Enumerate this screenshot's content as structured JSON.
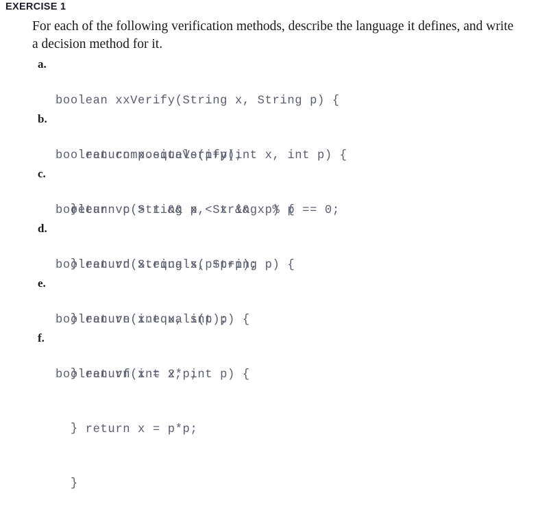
{
  "heading": "EXERCISE 1",
  "intro": {
    "line1": "For each of the following verification methods, describe the language it defines, and write",
    "line2": "a decision method for it."
  },
  "colors": {
    "page_background": "#ffffff",
    "heading_text": "#1b1b2b",
    "body_text": "#1a1a1a",
    "code_text": "#5a5f70"
  },
  "items": [
    {
      "marker": "a.",
      "signature": "boolean xxVerify(String x, String p) {",
      "body": "    return x.equals(p+p);",
      "close": "  }"
    },
    {
      "marker": "b.",
      "signature": "boolean compositeVerify(int x, int p) {",
      "body": "  return p > 1 && p < x && x % p == 0;",
      "close": "  }"
    },
    {
      "marker": "c.",
      "signature": "boolean vc(String x, String p) {",
      "body": "    return x.equals(p+p+p);",
      "close": "  }"
    },
    {
      "marker": "d.",
      "signature": "boolean vd(String x, String p) {",
      "body": "    return x.equals(p);",
      "close": "  }"
    },
    {
      "marker": "e.",
      "signature": "boolean ve(int x, int p) {",
      "body": "    return x = 2*p;",
      "close": "  }"
    },
    {
      "marker": "f.",
      "signature": "boolean vf(int x, int p) {",
      "body": "    return x = p*p;",
      "close": "  }"
    }
  ]
}
